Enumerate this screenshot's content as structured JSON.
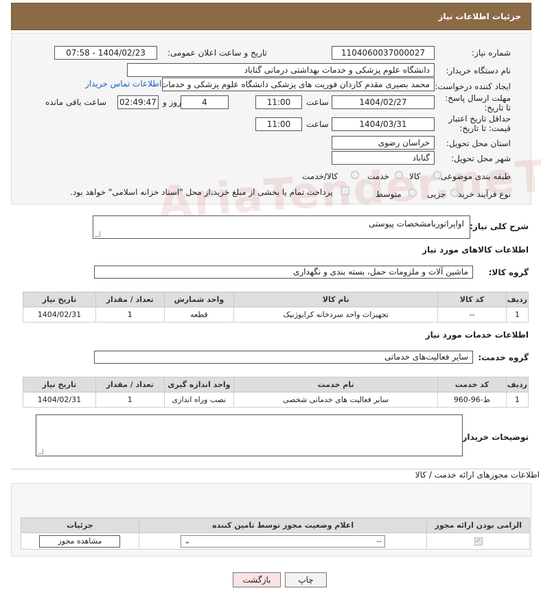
{
  "page_title": "جزئیات اطلاعات نیاز",
  "need_number": {
    "label": "شماره نیاز:",
    "value": "1104060037000027"
  },
  "announce": {
    "label": "تاریخ و ساعت اعلان عمومی:",
    "value": "1404/02/23 - 07:58"
  },
  "buyer_org": {
    "label": "نام دستگاه خریدار:",
    "value": "دانشگاه علوم پزشکی و خدمات بهداشتی درمانی گناباد"
  },
  "requester": {
    "label": "ایجاد کننده درخواست:",
    "value": "محمد بصیری مقدم کاردان فوریت های پزشکی دانشگاه علوم پزشکی و خدمات ب",
    "contact_link": "اطلاعات تماس خریدار"
  },
  "deadline": {
    "label": "مهلت ارسال پاسخ: تا تاریخ:",
    "date": "1404/02/27",
    "time_label": "ساعت",
    "time": "11:00",
    "days": "4",
    "days_label": "روز و",
    "remaining": "02:49:47",
    "remaining_label": "ساعت باقی مانده"
  },
  "price_validity": {
    "label": "حداقل تاریخ اعتبار قیمت: تا تاریخ:",
    "date": "1404/03/31",
    "time_label": "ساعت",
    "time": "11:00"
  },
  "delivery_province": {
    "label": "استان محل تحویل:",
    "value": "خراسان رضوی"
  },
  "delivery_city": {
    "label": "شهر محل تحویل:",
    "value": "گناباد"
  },
  "category": {
    "label": "طبقه بندی موضوعی:",
    "options": [
      "کالا",
      "خدمت",
      "کالا/خدمت"
    ]
  },
  "process": {
    "label": "نوع فرآیند خرید :",
    "options": [
      "جزیی",
      "متوسط"
    ],
    "payment_note": "پرداخت تمام یا بخشی از مبلغ خرید،از محل \"اسناد خزانه اسلامی\" خواهد بود."
  },
  "general_desc": {
    "label": "شرح کلی نیاز:",
    "value": "اواپراتوربامشخصات پیوستی"
  },
  "goods_section": {
    "title": "اطلاعات کالاهای مورد نیاز",
    "group_label": "گروه کالا:",
    "group_value": "ماشین آلات و ملزومات حمل، بسته بندی و نگهداری",
    "headers": [
      "ردیف",
      "کد کالا",
      "نام کالا",
      "واحد شمارش",
      "تعداد / مقدار",
      "تاریخ نیاز"
    ],
    "rows": [
      [
        "1",
        "--",
        "تجهیزات واحد سردخانه کرایوژنیک",
        "قطعه",
        "1",
        "1404/02/31"
      ]
    ]
  },
  "services_section": {
    "title": "اطلاعات خدمات مورد نیاز",
    "group_label": "گروه خدمت:",
    "group_value": "سایر فعالیت‌های خدماتی",
    "headers": [
      "ردیف",
      "کد خدمت",
      "نام خدمت",
      "واحد اندازه گیری",
      "تعداد / مقدار",
      "تاریخ نیاز"
    ],
    "rows": [
      [
        "1",
        "ط-96-960",
        "سایر فعالیت های خدماتی شخصی",
        "نصب وراه اندازی",
        "1",
        "1404/02/31"
      ]
    ]
  },
  "buyer_notes": {
    "label": "توضیحات خریدار:",
    "value": ""
  },
  "permits": {
    "title": "اطلاعات مجوزهای ارائه خدمت / کالا",
    "headers": [
      "الزامی بودن ارائه مجوز",
      "اعلام وضعیت مجوز توسط تامین کننده",
      "جزئیات"
    ],
    "select_value": "--",
    "view_button": "مشاهده مجوز"
  },
  "buttons": {
    "print": "چاپ",
    "back": "بازگشت"
  },
  "watermark": "AriaTender.neT"
}
